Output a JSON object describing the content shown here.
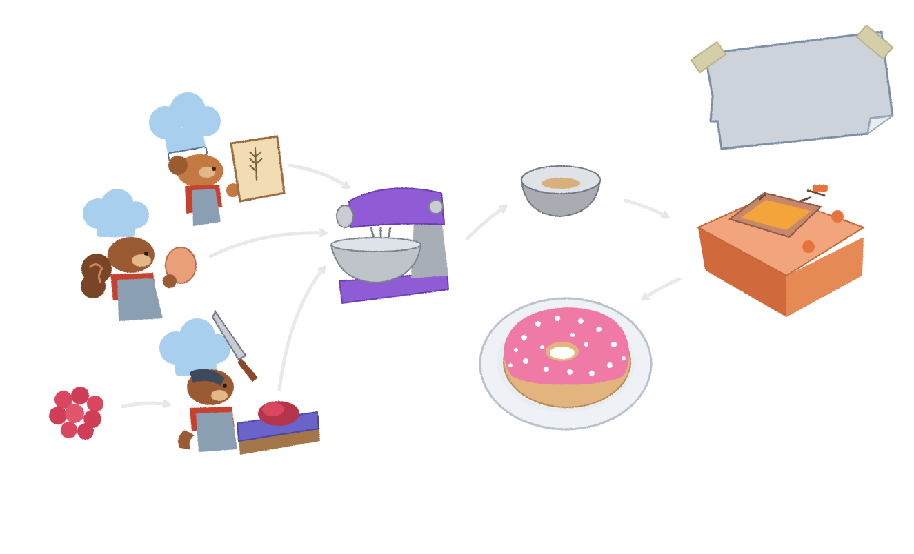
{
  "diagram": {
    "theme": "donut production flow",
    "nodes": [
      {
        "id": "chef-flour",
        "icon": "squirrel-chef-with-flour-bag-icon"
      },
      {
        "id": "chef-egg",
        "icon": "squirrel-chef-with-egg-icon"
      },
      {
        "id": "chef-knife",
        "icon": "squirrel-chef-cutting-berries-icon"
      },
      {
        "id": "raspberries",
        "icon": "raspberries-icon"
      },
      {
        "id": "mixer",
        "icon": "stand-mixer-icon"
      },
      {
        "id": "bowl",
        "icon": "dough-bowl-icon"
      },
      {
        "id": "fryer",
        "icon": "deep-fryer-icon"
      },
      {
        "id": "donut",
        "icon": "pink-sprinkle-donut-icon"
      },
      {
        "id": "note",
        "icon": "taped-paper-note-icon"
      }
    ],
    "edges": [
      {
        "from": "chef-flour",
        "to": "mixer"
      },
      {
        "from": "chef-egg",
        "to": "mixer"
      },
      {
        "from": "chef-knife",
        "to": "mixer"
      },
      {
        "from": "raspberries",
        "to": "chef-knife"
      },
      {
        "from": "mixer",
        "to": "bowl"
      },
      {
        "from": "bowl",
        "to": "fryer"
      },
      {
        "from": "fryer",
        "to": "donut"
      }
    ]
  },
  "colors": {
    "mixer": "#8f5bd6",
    "chef_hat": "#a9cfee",
    "squirrel_fur": "#9a5a32",
    "apron": "#7f97a8",
    "scarf": "#c8402e",
    "donut_icing": "#f07aa6",
    "donut_dough": "#e2b57f",
    "fryer": "#e58a55",
    "fryer_oil": "#f3a43a",
    "raspberry": "#d8465e",
    "note_paper": "#cdd3db",
    "tape": "#d4cfa8",
    "arrow": "#e6e6e6"
  }
}
